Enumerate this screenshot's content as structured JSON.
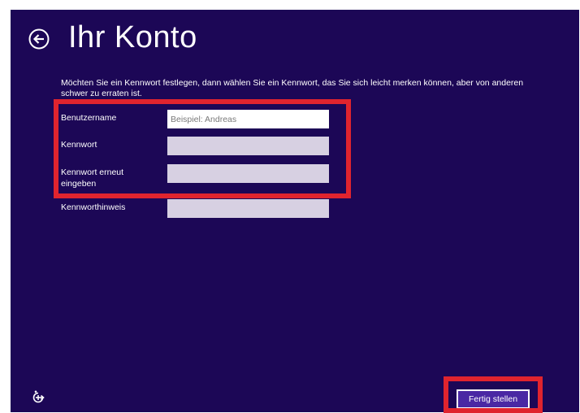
{
  "page": {
    "title": "Ihr Konto",
    "intro": "Möchten Sie ein Kennwort festlegen, dann wählen Sie ein Kennwort, das Sie sich leicht merken können, aber von anderen schwer zu erraten ist."
  },
  "form": {
    "username": {
      "label": "Benutzername",
      "value": "",
      "placeholder": "Beispiel: Andreas"
    },
    "password": {
      "label": "Kennwort",
      "value": "",
      "placeholder": ""
    },
    "password_repeat": {
      "label": "Kennwort erneut eingeben",
      "value": "",
      "placeholder": ""
    },
    "hint": {
      "label": "Kennworthinweis",
      "value": "",
      "placeholder": ""
    }
  },
  "buttons": {
    "finish_label": "Fertig stellen"
  },
  "icons": {
    "back": "back-arrow-circle-icon",
    "ease_of_access": "ease-of-access-icon"
  },
  "colors": {
    "background": "#1c0756",
    "highlight": "#e0242e",
    "button": "#4a28a4",
    "input_active": "#ffffff",
    "input_inactive": "#d7d0e2"
  }
}
